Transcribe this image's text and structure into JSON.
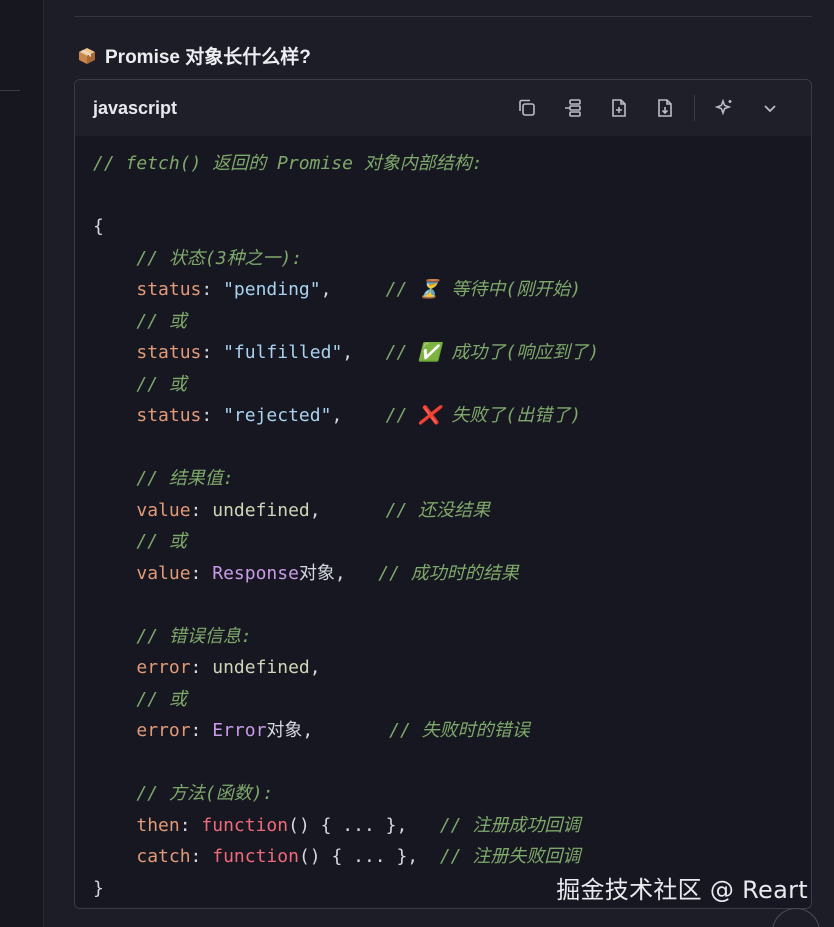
{
  "section": {
    "title": "Promise 对象长什么样?",
    "icon": "package-icon"
  },
  "code_block": {
    "language": "javascript",
    "toolbar": [
      {
        "name": "copy-icon"
      },
      {
        "name": "outline-icon"
      },
      {
        "name": "insert-file-icon"
      },
      {
        "name": "download-file-icon"
      },
      {
        "name": "ai-sparkle-icon"
      },
      {
        "name": "chevron-down-icon"
      }
    ],
    "lines": {
      "l1": "// fetch() 返回的 Promise 对象内部结构:",
      "l3": "{",
      "l4": "// 状态(3种之一):",
      "l5_key": "status",
      "l5_val": "\"pending\"",
      "l5_cm": "// ⏳ 等待中(刚开始)",
      "l6": "// 或",
      "l7_key": "status",
      "l7_val": "\"fulfilled\"",
      "l7_cm": "// ✅ 成功了(响应到了)",
      "l8": "// 或",
      "l9_key": "status",
      "l9_val": "\"rejected\"",
      "l9_cm": "// ❌ 失败了(出错了)",
      "l11": "// 结果值:",
      "l12_key": "value",
      "l12_val": "undefined",
      "l12_cm": "// 还没结果",
      "l13": "// 或",
      "l14_key": "value",
      "l14_cls": "Response",
      "l14_tail": "对象,",
      "l14_cm": "// 成功时的结果",
      "l16": "// 错误信息:",
      "l17_key": "error",
      "l17_val": "undefined",
      "l18": "// 或",
      "l19_key": "error",
      "l19_cls": "Error",
      "l19_tail": "对象,",
      "l19_cm": "// 失败时的错误",
      "l21": "// 方法(函数):",
      "l22_key": "then",
      "l22_fn": "function",
      "l22_body": "() { ... },",
      "l22_cm": "// 注册成功回调",
      "l23_key": "catch",
      "l23_fn": "function",
      "l23_body": "() { ... },",
      "l23_cm": "// 注册失败回调",
      "l24": "}"
    }
  },
  "watermark": "掘金技术社区 @ Reart",
  "colors": {
    "background": "#1c1d27",
    "comment": "#7fa86b",
    "key": "#e39a78",
    "string": "#a9d3f0",
    "class": "#c99be8",
    "function": "#ef6a7a"
  }
}
